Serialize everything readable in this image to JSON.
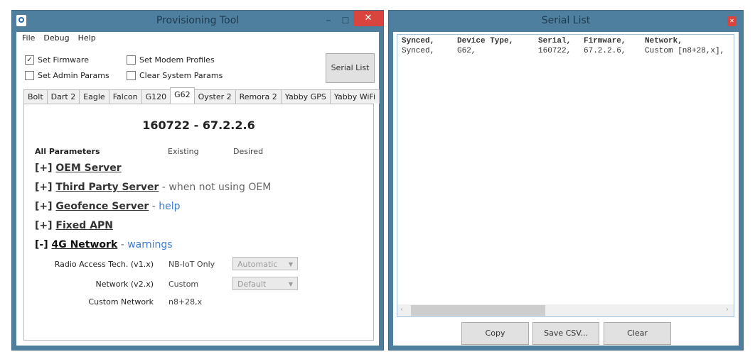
{
  "left_window": {
    "title": "Provisioning Tool",
    "menu": [
      "File",
      "Debug",
      "Help"
    ],
    "checkboxes": [
      {
        "label": "Set Firmware",
        "checked": true
      },
      {
        "label": "Set Admin Params",
        "checked": false
      },
      {
        "label": "Set Modem Profiles",
        "checked": false
      },
      {
        "label": "Clear System Params",
        "checked": false
      }
    ],
    "serial_list_button": "Serial List",
    "tabs": [
      "Bolt",
      "Dart 2",
      "Eagle",
      "Falcon",
      "G120",
      "G62",
      "Oyster 2",
      "Remora 2",
      "Yabby GPS",
      "Yabby WiFi"
    ],
    "active_tab": "G62",
    "device_heading": "160722 - 67.2.2.6",
    "headers": {
      "params": "All Parameters",
      "existing": "Existing",
      "desired": "Desired"
    },
    "sections": [
      {
        "toggle": "[+]",
        "name": "OEM Server",
        "suffix": "",
        "link": ""
      },
      {
        "toggle": "[+]",
        "name": "Third Party Server",
        "suffix": " - when not using OEM",
        "link": ""
      },
      {
        "toggle": "[+]",
        "name": "Geofence Server",
        "suffix": " - ",
        "link": "help"
      },
      {
        "toggle": "[+]",
        "name": "Fixed APN",
        "suffix": "",
        "link": ""
      },
      {
        "toggle": "[-]",
        "name": "4G Network",
        "suffix": " - ",
        "link": "warnings"
      }
    ],
    "rows": [
      {
        "label": "Radio Access Tech. (v1.x)",
        "existing": "NB-IoT Only",
        "desired": "Automatic"
      },
      {
        "label": "Network (v2.x)",
        "existing": "Custom",
        "desired": "Default"
      },
      {
        "label": "Custom Network",
        "existing": "n8+28,x",
        "desired": null
      }
    ]
  },
  "right_window": {
    "title": "Serial List",
    "columns": [
      "Synced,",
      "Device Type,",
      "Serial,",
      "Firmware,",
      "Network,"
    ],
    "rows": [
      [
        "Synced,",
        "G62,",
        "160722,",
        "67.2.2.6,",
        "Custom [n8+28,x],"
      ]
    ],
    "buttons": {
      "copy": "Copy",
      "save": "Save CSV...",
      "clear": "Clear"
    }
  }
}
